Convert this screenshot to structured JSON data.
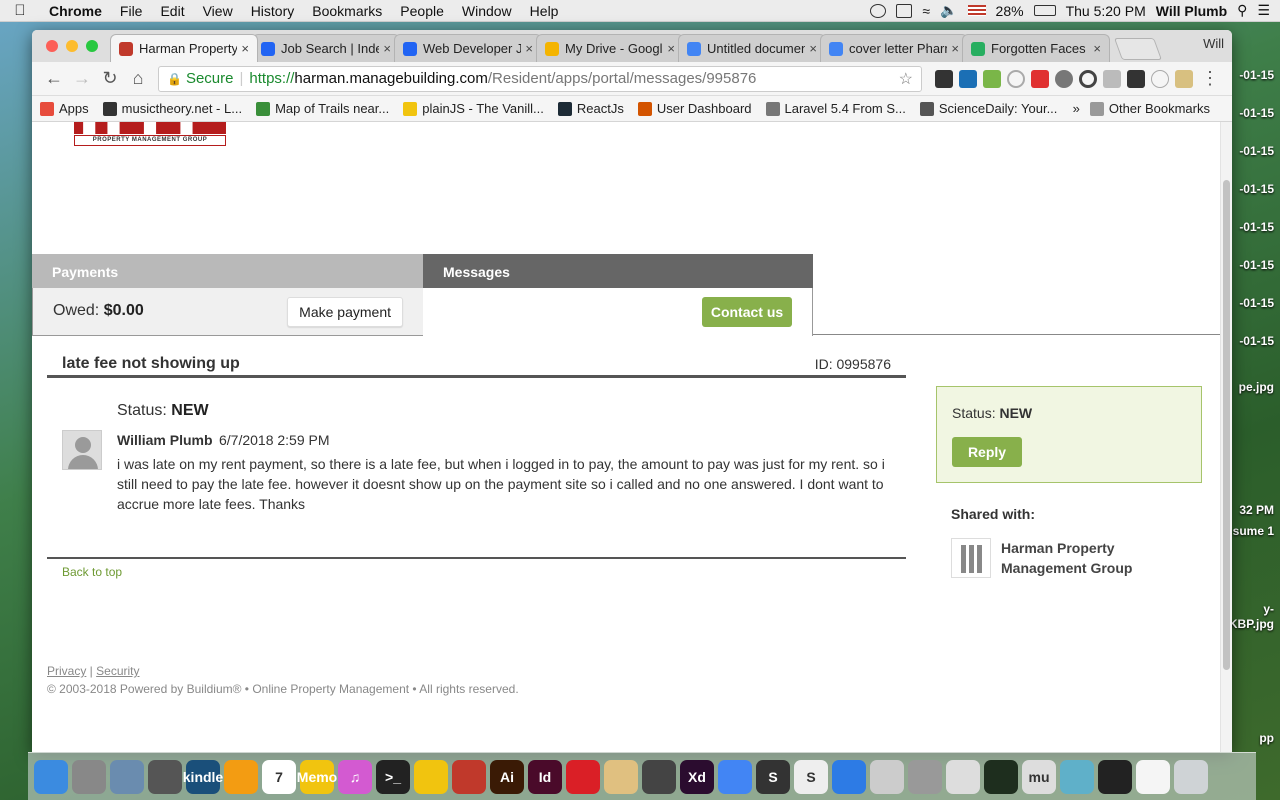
{
  "menubar": {
    "app": "Chrome",
    "items": [
      "File",
      "Edit",
      "View",
      "History",
      "Bookmarks",
      "People",
      "Window",
      "Help"
    ],
    "battery": "28%",
    "clock": "Thu 5:20 PM",
    "user": "Will Plumb"
  },
  "desktop": {
    "items": [
      "-01-15",
      "-01-15",
      "-01-15",
      "-01-15",
      "-01-15",
      "-01-15",
      "-01-15",
      "-01-15",
      "pe.jpg",
      "32 PM",
      "sume 1",
      "y-",
      "KBP.jpg",
      "pp"
    ]
  },
  "browser": {
    "tabs": [
      {
        "title": "Harman Property",
        "active": true,
        "color": "#c0392b"
      },
      {
        "title": "Job Search | Indeed",
        "active": false,
        "color": "#2164f3"
      },
      {
        "title": "Web Developer Jobs",
        "active": false,
        "color": "#2164f3"
      },
      {
        "title": "My Drive - Google Drive",
        "active": false,
        "color": "#f4b400"
      },
      {
        "title": "Untitled document",
        "active": false,
        "color": "#4285f4"
      },
      {
        "title": "cover letter Pharmacy",
        "active": false,
        "color": "#4285f4"
      },
      {
        "title": "Forgotten Faces",
        "active": false,
        "color": "#27ae60"
      }
    ],
    "profile": "Will",
    "secure_label": "Secure",
    "url_scheme": "https://",
    "url_host": "harman.managebuilding.com",
    "url_path": "/Resident/apps/portal/messages/995876",
    "bookmarks": [
      {
        "label": "Apps",
        "color": "#e74c3c"
      },
      {
        "label": "musictheory.net - L...",
        "color": "#333333"
      },
      {
        "label": "Map of Trails near...",
        "color": "#3a8f3a"
      },
      {
        "label": "plainJS - The Vanill...",
        "color": "#f1c40f"
      },
      {
        "label": "ReactJs",
        "color": "#1d2b36"
      },
      {
        "label": "User Dashboard",
        "color": "#d35400"
      },
      {
        "label": "Laravel 5.4 From S...",
        "color": "#777777"
      },
      {
        "label": "ScienceDaily: Your...",
        "color": "#555555"
      }
    ],
    "other_bookmarks": "Other Bookmarks"
  },
  "page": {
    "logo_text": "PROPERTY MANAGEMENT GROUP",
    "payments_tab": "Payments",
    "messages_tab": "Messages",
    "owed_label": "Owed:",
    "owed_value": "$0.00",
    "make_payment": "Make payment",
    "contact_us": "Contact us",
    "message": {
      "subject": "late fee not showing up",
      "id_text": "ID: 0995876",
      "status_label": "Status:",
      "status_value": "NEW",
      "author": "William Plumb",
      "date": "6/7/2018 2:59 PM",
      "body": "i was late on my rent payment, so there is a late fee, but when i logged in to pay, the amount to pay was just for my rent. so i still need to pay the late fee. however it doesnt show up on the payment site so i called and no one answered. I dont want to accrue more late fees. Thanks"
    },
    "back_to_top": "Back to top",
    "sidebar": {
      "status_label": "Status:",
      "status_value": "NEW",
      "reply": "Reply",
      "shared_with": "Shared with:",
      "shared_name": "Harman Property Management Group"
    },
    "footer": {
      "privacy": "Privacy",
      "security": "Security",
      "copyright": "© 2003-2018 Powered by Buildium® • Online Property Management • All rights reserved."
    }
  },
  "dock": [
    {
      "name": "finder",
      "color": "#3b8be0",
      "glyph": ""
    },
    {
      "name": "calculator",
      "color": "#888888",
      "glyph": ""
    },
    {
      "name": "preview",
      "color": "#6a8caf",
      "glyph": ""
    },
    {
      "name": "pen-tool",
      "color": "#555555",
      "glyph": ""
    },
    {
      "name": "kindle",
      "color": "#1a4f7a",
      "glyph": "kindle"
    },
    {
      "name": "books",
      "color": "#f39c12",
      "glyph": ""
    },
    {
      "name": "calendar",
      "color": "#ffffff",
      "glyph": "7"
    },
    {
      "name": "memo",
      "color": "#f1c40f",
      "glyph": "Memo"
    },
    {
      "name": "itunes",
      "color": "#d35ad1",
      "glyph": "♫"
    },
    {
      "name": "terminal",
      "color": "#222222",
      "glyph": ">_"
    },
    {
      "name": "cyberduck",
      "color": "#f1c40f",
      "glyph": ""
    },
    {
      "name": "sketchup",
      "color": "#c0392b",
      "glyph": ""
    },
    {
      "name": "illustrator",
      "color": "#3a1a05",
      "glyph": "Ai"
    },
    {
      "name": "indesign",
      "color": "#4a0a2a",
      "glyph": "Id"
    },
    {
      "name": "creative-cloud",
      "color": "#da1f26",
      "glyph": ""
    },
    {
      "name": "sequel-pro",
      "color": "#e0c080",
      "glyph": ""
    },
    {
      "name": "safari-alt",
      "color": "#444444",
      "glyph": ""
    },
    {
      "name": "adobe-xd",
      "color": "#2b0c2f",
      "glyph": "Xd"
    },
    {
      "name": "chrome",
      "color": "#4285f4",
      "glyph": ""
    },
    {
      "name": "sublime",
      "color": "#333333",
      "glyph": "S"
    },
    {
      "name": "scrivener",
      "color": "#eeeeee",
      "glyph": "S"
    },
    {
      "name": "maps",
      "color": "#2d7be5",
      "glyph": ""
    },
    {
      "name": "scanner",
      "color": "#cccccc",
      "glyph": ""
    },
    {
      "name": "eye-app",
      "color": "#999999",
      "glyph": ""
    },
    {
      "name": "sequel",
      "color": "#dddddd",
      "glyph": ""
    },
    {
      "name": "activity-monitor",
      "color": "#1e2e1e",
      "glyph": ""
    },
    {
      "name": "musescore",
      "color": "#dddddd",
      "glyph": "mu"
    },
    {
      "name": "anchor-app",
      "color": "#5fb0c9",
      "glyph": ""
    },
    {
      "name": "tuner",
      "color": "#222222",
      "glyph": ""
    },
    {
      "name": "documents",
      "color": "#f5f5f5",
      "glyph": ""
    },
    {
      "name": "trash",
      "color": "#cfd3d6",
      "glyph": ""
    }
  ]
}
